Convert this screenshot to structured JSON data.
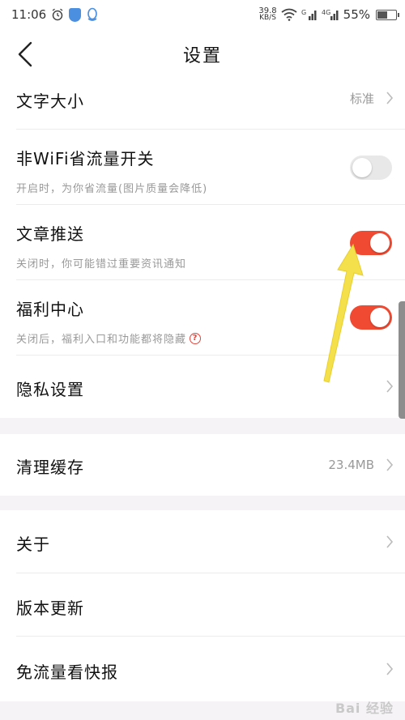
{
  "status_bar": {
    "time": "11:06",
    "net_speed": "39.8",
    "net_unit": "KB/S",
    "battery": "55%",
    "battery_level": 0.55
  },
  "header": {
    "title": "设置"
  },
  "settings": {
    "font_size": {
      "label": "文字大小",
      "value": "标准"
    },
    "wifi_saver": {
      "label": "非WiFi省流量开关",
      "desc": "开启时，为你省流量(图片质量会降低)",
      "enabled": false
    },
    "article_push": {
      "label": "文章推送",
      "desc": "关闭时，你可能错过重要资讯通知",
      "enabled": true
    },
    "welfare_center": {
      "label": "福利中心",
      "desc": "关闭后，福利入口和功能都将隐藏",
      "help_glyph": "?",
      "enabled": true
    },
    "privacy": {
      "label": "隐私设置"
    }
  },
  "storage": {
    "clear_cache": {
      "label": "清理缓存",
      "value": "23.4MB"
    }
  },
  "about": {
    "about_label": "关于",
    "version_update_label": "版本更新",
    "free_data_label": "免流量看快报"
  },
  "watermark": "Bai 经验",
  "colors": {
    "toggle_on": "#f04a32",
    "toggle_off": "#e8e8e8",
    "arrow": "#f4e04b",
    "help": "#e0453a"
  }
}
